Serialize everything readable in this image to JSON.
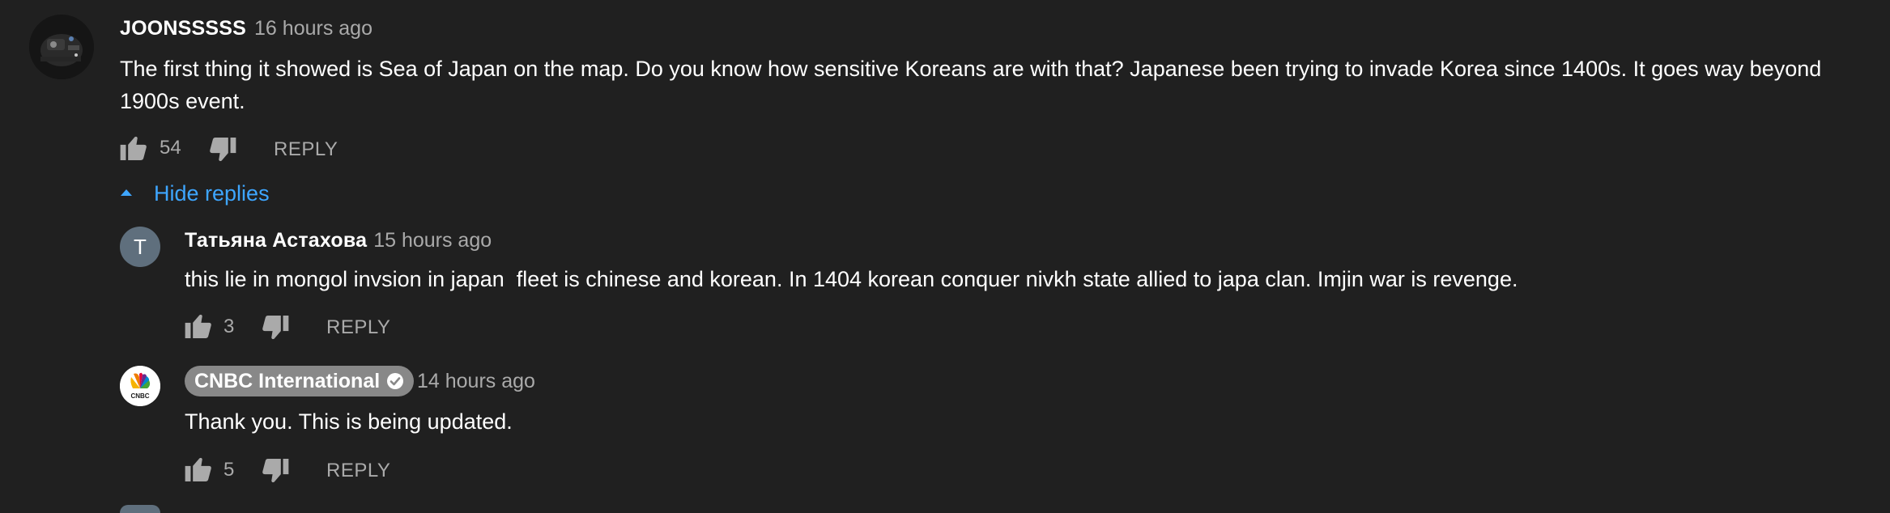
{
  "comment": {
    "author": "JOONSSSSS",
    "time": "16 hours ago",
    "text": "The first thing it showed is Sea of Japan on the map. Do you know how sensitive Koreans are with that? Japanese been trying to invade Korea since 1400s. It goes way beyond 1900s event.",
    "likes": "54",
    "reply_label": "REPLY",
    "hide_replies_label": "Hide replies"
  },
  "replies": [
    {
      "author": "Татьяна Астахова",
      "avatar_letter": "T",
      "time": "15 hours ago",
      "text": "this lie in mongol invsion in japan  fleet is chinese and korean. In 1404 korean conquer nivkh state allied to japa clan. Imjin war is revenge.",
      "likes": "3",
      "reply_label": "REPLY"
    },
    {
      "author": "CNBC International",
      "avatar_logo_text": "CNBC",
      "verified": true,
      "time": "14 hours ago",
      "text": "Thank you. This is being updated.",
      "likes": "5",
      "reply_label": "REPLY"
    }
  ],
  "icons": {
    "like": "thumbs-up-icon",
    "dislike": "thumbs-down-icon",
    "collapse": "caret-up-icon",
    "verified": "verified-check-icon"
  },
  "colors": {
    "background": "#202020",
    "link": "#3ea6ff",
    "secondary_text": "#aaaaaa",
    "channel_badge": "#888888"
  }
}
